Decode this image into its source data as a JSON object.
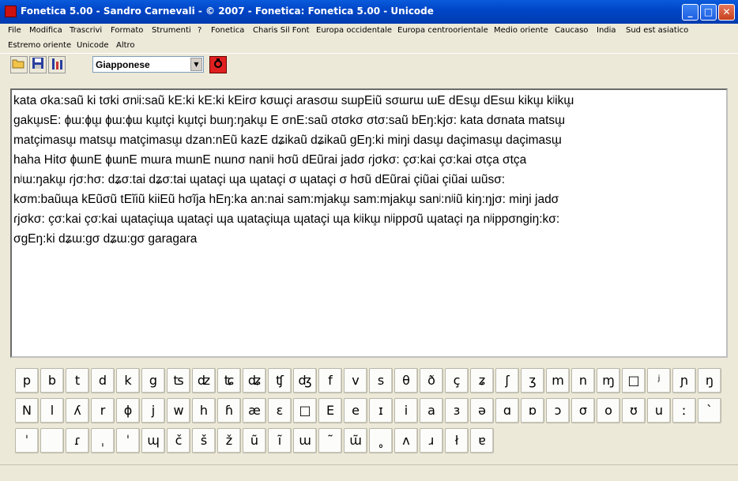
{
  "window": {
    "title": "Fonetica 5.00 - Sandro Carnevali - ©  2007 - Fonetica: Fonetica 5.00 - Unicode"
  },
  "menu": [
    "File",
    "Modifica",
    "Trascrivi",
    "Formato",
    "Strumenti",
    "?",
    "Fonetica",
    "Charis Sil Font",
    "Europa occidentale",
    "Europa centroorientale",
    "Medio oriente",
    "Caucaso",
    "India",
    "Sud est asiatico",
    "Estremo oriente",
    "Unicode",
    "Altro"
  ],
  "toolbar": {
    "language": "Giapponese"
  },
  "text_lines": [
    "kata σka:saũ ki tσki σnʲi:saũ kE:ki kE:ki kEirσ kσɯçi arasσɯ sɯpEiũ sσɯrɯ ɯE dEsɯ̥ dEsɯ kikɯ̥ kʲikɯ̥",
    "gakɯ̥sE: ɸɯ:ɸɯ̥ ɸɯ:ɸɯ kɯ̥tçi kɯ̥tçi bɯŋ:ŋakɯ̥ E σnE:saũ σtσkσ σtσ:saũ bEŋ:kjσ: kata dσnata matsɯ̥",
    "matçimasɯ̥ matsɯ̥ matçimasɯ̥ dzan:nEũ kazE dʑikaũ dʑikaũ gEŋ:ki miŋi dasɯ̥ daçimasɯ̥ daçimasɯ̥",
    "haha Hitσ ɸɯnE ɸɯnE mɯra mɯnE nɯnσ nanʲi hσũ dEũrai jadσ ɾjσkσ: çσ:kai çσ:kai σtça σtça",
    "nʲɯ:ŋakɯ̥ ɾjσ:hσ: dʑσ:tai dʑσ:tai ɰataçi ɰa ɰataçi σ ɰataçi σ hσũ dEũrai çiũai çiũai ɯũsσ:",
    "kσm:baũɰa kEũσũ tEĩiũ kiiEũ hσĩja hEŋ:ka an:nai sam:mjakɯ̥ sam:mjakɯ̥ sanʲ:nʲiũ kiŋ:ŋjσ: miŋi jadσ",
    "ɾjσkσ: çσ:kai çσ:kai ɰataçiɰa ɰataçi ɰa ɰataçiɰa ɰataçi ɰa kʲikɯ̥ nʲippσũ ɰataçi ŋa nʲippσngiŋ:kσ:",
    "σgEŋ:ki dʑɯ:gσ dʑɯ:gσ garagara"
  ],
  "keyboard": {
    "row1": [
      "p",
      "b",
      "t",
      "d",
      "k",
      "g",
      "ʦ",
      "ʣ",
      "ʨ",
      "ʥ",
      "ʧ",
      "ʤ",
      "f",
      "v",
      "s",
      "θ",
      "ð",
      "ç",
      "ʑ",
      "ʃ",
      "ʒ",
      "m",
      "n",
      "ɱ",
      "□",
      "ʲ",
      "ɲ",
      "ŋ"
    ],
    "row2": [
      "N",
      "l",
      "ʎ",
      "r",
      "ɸ",
      "j",
      "w",
      "h",
      "ɦ",
      "æ",
      "ɛ",
      "□",
      "E",
      "e",
      "ɪ",
      "i",
      "a",
      "ɜ",
      "ə",
      "ɑ",
      "ɒ",
      "ɔ",
      "σ",
      "o",
      "ʊ",
      "u",
      "ː",
      "ˋ"
    ],
    "row3": [
      "ˈ",
      "",
      "ɾ",
      "ˌ",
      "ˈ",
      "ɰ",
      "č",
      "š",
      "ž",
      "ũ",
      "ĩ",
      "ɯ",
      "˜",
      "ɯ̃",
      "˳",
      "ʌ",
      "ɹ",
      "ł",
      "ɐ"
    ]
  }
}
